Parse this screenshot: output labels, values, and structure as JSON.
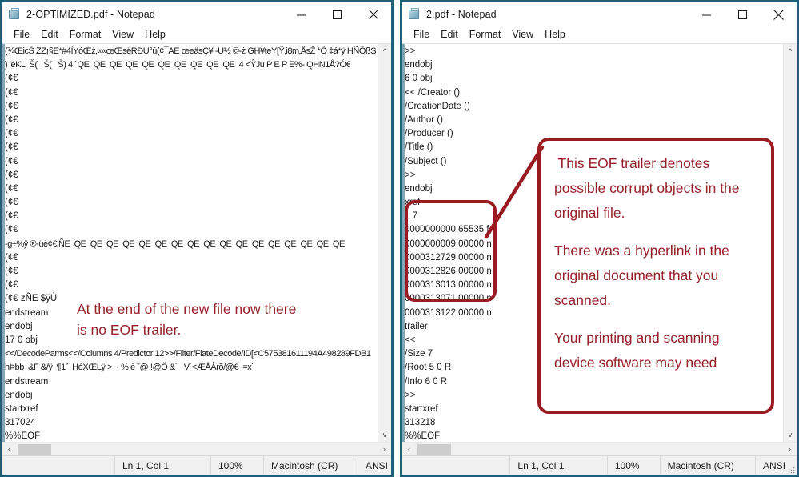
{
  "windows": [
    {
      "id": "left",
      "title": "2-OPTIMIZED.pdf - Notepad",
      "menu": [
        "File",
        "Edit",
        "Format",
        "View",
        "Help"
      ],
      "controls": {
        "minimize": "minimize-button",
        "maximize": "maximize-button",
        "close": "close-button"
      },
      "lines": [
        "(¾ŒicŠ ZZ¡§E*#4ÌYóŒż‚««œŒsëRÐÚ°ú(¢¯AE œeäsÇ¥ -U½ ©-ż GH¥teY[Ŷ‚i8m‚ÅsŽ *Õ ‡á*ÿ HÑÕßS",
        ") 'éKL  Š(   Š(   Š) 4 ˙QE  QE  QE  QE  QE  QE  QE  QE  QE  QE  4 <ŶJu P E P E%- QHN1Å?Ó€",
        "(¢€",
        "(¢€",
        "(¢€",
        "(¢€",
        "(¢€",
        "(¢€",
        "(¢€",
        "(¢€",
        "(¢€",
        "(¢€",
        "(¢€",
        "(¢€",
        "-g÷%ÿ ®-üė¢€‚ÑE  QE  QE  QE  QE  QE  QE  QE  QE  QE  QE  QE  QE  QE  QE  QE  QE  QE",
        "(¢€",
        "(¢€",
        "(¢€",
        "(¢€ zÑE $ÿÙ",
        "endstream",
        "endobj",
        "17 0 obj",
        "<</DecodeParms<</Columns 4/Predictor 12>>/Filter/FlateDecode/ID[<C575381611194A498289FDB1",
        "hÞbb  &F &/ÿ  ¶1ˇ  HóXŒLÿ >  · % ė ˇ@ !@Ö &˙   V˙<ÆÅÀrõ/@€  =x˙",
        "endstream",
        "endobj",
        "startxref",
        "317024",
        "%%EOF"
      ],
      "status": {
        "position": "Ln 1, Col 1",
        "zoom": "100%",
        "line_ending": "Macintosh (CR)",
        "encoding": "ANSI"
      }
    },
    {
      "id": "right",
      "title": "2.pdf - Notepad",
      "menu": [
        "File",
        "Edit",
        "Format",
        "View",
        "Help"
      ],
      "controls": {
        "minimize": "minimize-button",
        "maximize": "maximize-button",
        "close": "close-button"
      },
      "lines": [
        ">>",
        "endobj",
        "6 0 obj",
        "<< /Creator ()",
        "/CreationDate ()",
        "/Author ()",
        "/Producer ()",
        "/Title ()",
        "/Subject ()",
        ">>",
        "endobj",
        "xref",
        "1 7",
        "0000000000 65535 f",
        "0000000009 00000 n",
        "0000312729 00000 n",
        "0000312826 00000 n",
        "0000313013 00000 n",
        "0000313071 00000 n",
        "0000313122 00000 n",
        "trailer",
        "<<",
        "/Size 7",
        "/Root 5 0 R",
        "/Info 6 0 R",
        ">>",
        "startxref",
        "313218",
        "%%EOF"
      ],
      "status": {
        "position": "Ln 1, Col 1",
        "zoom": "100%",
        "line_ending": "Macintosh (CR)",
        "encoding": "ANSI"
      }
    }
  ],
  "annotations": {
    "color": "#96212b",
    "border_color": "#9b1b22",
    "left_note": "At the end of the new file now there\nis no EOF trailer.",
    "callout_paragraphs": [
      " This EOF trailer denotes",
      "possible corrupt objects in the",
      "original file.",
      "",
      "There was a hyperlink in the",
      "original document that you",
      "scanned.",
      "",
      "Your printing and scanning",
      "device software may need"
    ]
  },
  "scrollbars": {
    "up_arrow": "^",
    "down_arrow": "v",
    "left_arrow": "‹",
    "right_arrow": "›"
  }
}
